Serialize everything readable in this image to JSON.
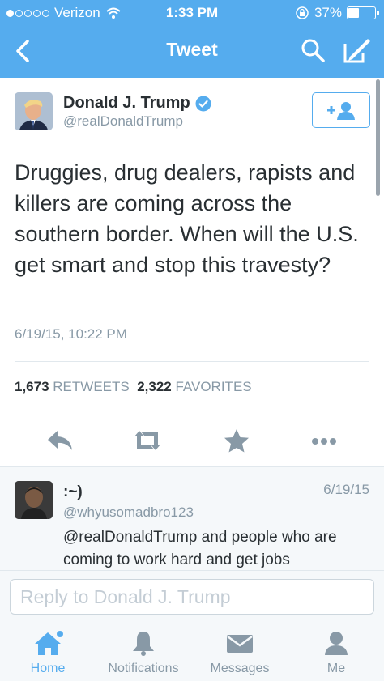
{
  "status_bar": {
    "carrier": "Verizon",
    "time": "1:33 PM",
    "battery": "37%",
    "battery_level": 0.37
  },
  "nav": {
    "title": "Tweet",
    "back_icon": "chevron-left-icon",
    "search_icon": "search-icon",
    "compose_icon": "compose-icon"
  },
  "tweet": {
    "author_name": "Donald J. Trump",
    "author_handle": "@realDonaldTrump",
    "verified": true,
    "text": "Druggies, drug dealers, rapists and killers are coming across the southern border. When will the U.S. get smart and stop this travesty?",
    "timestamp": "6/19/15, 10:22 PM",
    "retweets_count": "1,673",
    "retweets_label": "RETWEETS",
    "favorites_count": "2,322",
    "favorites_label": "FAVORITES",
    "follow_icon": "add-user-icon"
  },
  "reply": {
    "author_name": ":~)",
    "author_handle": "@whyusomadbro123",
    "date": "6/19/15",
    "text": "@realDonaldTrump and people who are coming to work hard and get jobs"
  },
  "composer": {
    "placeholder": "Reply to Donald J. Trump"
  },
  "tabs": [
    {
      "label": "Home",
      "icon": "home-icon",
      "active": true
    },
    {
      "label": "Notifications",
      "icon": "bell-icon",
      "active": false
    },
    {
      "label": "Messages",
      "icon": "envelope-icon",
      "active": false
    },
    {
      "label": "Me",
      "icon": "person-icon",
      "active": false
    }
  ],
  "colors": {
    "brand": "#55acee",
    "text": "#292f33",
    "muted": "#8899a6"
  }
}
